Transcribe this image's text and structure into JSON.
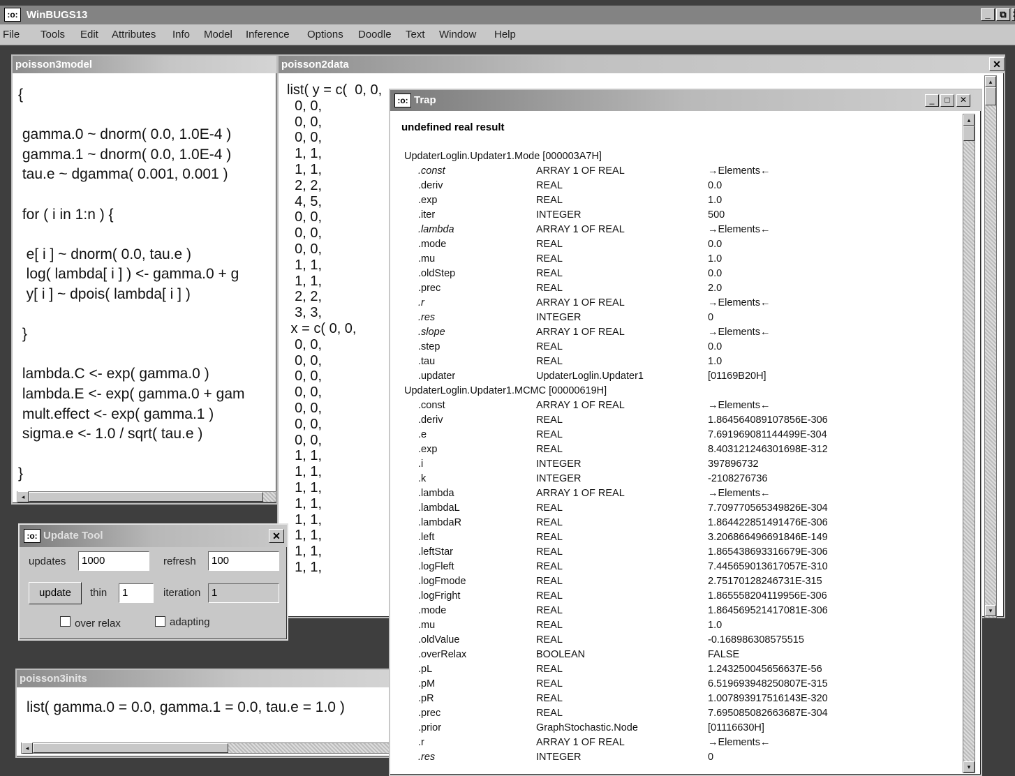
{
  "app": {
    "title": "WinBUGS13",
    "icon": "bug-icon",
    "minimize": "_",
    "restore": "⧉",
    "close": "✕"
  },
  "menu": [
    "File",
    "Tools",
    "Edit",
    "Attributes",
    "Info",
    "Model",
    "Inference",
    "Options",
    "Doodle",
    "Text",
    "Window",
    "Help"
  ],
  "model_window": {
    "title": "poisson3model",
    "code": "{\n\n gamma.0 ~ dnorm( 0.0, 1.0E-4 )\n gamma.1 ~ dnorm( 0.0, 1.0E-4 )\n tau.e ~ dgamma( 0.001, 0.001 )\n\n for ( i in 1:n ) {\n\n  e[ i ] ~ dnorm( 0.0, tau.e )\n  log( lambda[ i ] ) <- gamma.0 + g\n  y[ i ] ~ dpois( lambda[ i ] )\n\n }\n\n lambda.C <- exp( gamma.0 )\n lambda.E <- exp( gamma.0 + gam\n mult.effect <- exp( gamma.1 )\n sigma.e <- 1.0 / sqrt( tau.e )\n\n}"
  },
  "data_window": {
    "title": "poisson2data",
    "code": "list( y = c(  0, 0,\n  0, 0,\n  0, 0,\n  0, 0,\n  1, 1,\n  1, 1,\n  2, 2,\n  4, 5,\n  0, 0,\n  0, 0,\n  0, 0,\n  1, 1,\n  1, 1,\n  2, 2,\n  3, 3,\n x = c( 0, 0,\n  0, 0,\n  0, 0,\n  0, 0,\n  0, 0,\n  0, 0,\n  0, 0,\n  0, 0,\n  1, 1,\n  1, 1,\n  1, 1,\n  1, 1,\n  1, 1,\n  1, 1,\n  1, 1,\n  1, 1,",
    "close": "✕"
  },
  "trap_window": {
    "title": "Trap",
    "heading": "undefined real result",
    "rows": [
      {
        "name": "UpdaterLoglin.Updater1.Mode   [000003A7H]",
        "type": "",
        "value": "",
        "section": true
      },
      {
        "name": ".const",
        "type": "ARRAY 1 OF REAL",
        "value": "→Elements←",
        "italic": true
      },
      {
        "name": ".deriv",
        "type": "REAL",
        "value": "0.0"
      },
      {
        "name": ".exp",
        "type": "REAL",
        "value": "1.0"
      },
      {
        "name": ".iter",
        "type": "INTEGER",
        "value": "500"
      },
      {
        "name": ".lambda",
        "type": "ARRAY 1 OF REAL",
        "value": "→Elements←",
        "italic": true
      },
      {
        "name": ".mode",
        "type": "REAL",
        "value": "0.0"
      },
      {
        "name": ".mu",
        "type": "REAL",
        "value": "1.0"
      },
      {
        "name": ".oldStep",
        "type": "REAL",
        "value": "0.0"
      },
      {
        "name": ".prec",
        "type": "REAL",
        "value": "2.0"
      },
      {
        "name": ".r",
        "type": "ARRAY 1 OF REAL",
        "value": "→Elements←",
        "italic": true
      },
      {
        "name": ".res",
        "type": "INTEGER",
        "value": "0",
        "italic": true
      },
      {
        "name": ".slope",
        "type": "ARRAY 1 OF REAL",
        "value": "→Elements←",
        "italic": true
      },
      {
        "name": ".step",
        "type": "REAL",
        "value": "0.0"
      },
      {
        "name": ".tau",
        "type": "REAL",
        "value": "1.0"
      },
      {
        "name": ".updater",
        "type": "UpdaterLoglin.Updater1",
        "value": "[01169B20H]"
      },
      {
        "name": "UpdaterLoglin.Updater1.MCMC   [00000619H]",
        "type": "",
        "value": "",
        "section": true
      },
      {
        "name": ".const",
        "type": "ARRAY 1 OF REAL",
        "value": "→Elements←"
      },
      {
        "name": ".deriv",
        "type": "REAL",
        "value": "1.864564089107856E-306"
      },
      {
        "name": ".e",
        "type": "REAL",
        "value": "7.691969081144499E-304"
      },
      {
        "name": ".exp",
        "type": "REAL",
        "value": "8.403121246301698E-312"
      },
      {
        "name": ".i",
        "type": "INTEGER",
        "value": "397896732"
      },
      {
        "name": ".k",
        "type": "INTEGER",
        "value": "-2108276736"
      },
      {
        "name": ".lambda",
        "type": "ARRAY 1 OF REAL",
        "value": "→Elements←"
      },
      {
        "name": ".lambdaL",
        "type": "REAL",
        "value": "7.709770565349826E-304"
      },
      {
        "name": ".lambdaR",
        "type": "REAL",
        "value": "1.864422851491476E-306"
      },
      {
        "name": ".left",
        "type": "REAL",
        "value": "3.206866496691846E-149"
      },
      {
        "name": ".leftStar",
        "type": "REAL",
        "value": "1.865438693316679E-306"
      },
      {
        "name": ".logFleft",
        "type": "REAL",
        "value": "7.445659013617057E-310"
      },
      {
        "name": ".logFmode",
        "type": "REAL",
        "value": "2.75170128246731E-315"
      },
      {
        "name": ".logFright",
        "type": "REAL",
        "value": "1.865558204119956E-306"
      },
      {
        "name": ".mode",
        "type": "REAL",
        "value": "1.864569521417081E-306"
      },
      {
        "name": ".mu",
        "type": "REAL",
        "value": "1.0"
      },
      {
        "name": ".oldValue",
        "type": "REAL",
        "value": "-0.168986308575515"
      },
      {
        "name": ".overRelax",
        "type": "BOOLEAN",
        "value": "FALSE"
      },
      {
        "name": ".pL",
        "type": "REAL",
        "value": "1.243250045656637E-56"
      },
      {
        "name": ".pM",
        "type": "REAL",
        "value": "6.519693948250807E-315"
      },
      {
        "name": ".pR",
        "type": "REAL",
        "value": "1.007893917516143E-320"
      },
      {
        "name": ".prec",
        "type": "REAL",
        "value": "7.695085082663687E-304"
      },
      {
        "name": ".prior",
        "type": "GraphStochastic.Node",
        "value": "[01116630H]"
      },
      {
        "name": ".r",
        "type": "ARRAY 1 OF REAL",
        "value": "→Elements←"
      },
      {
        "name": ".res",
        "type": "INTEGER",
        "value": "0",
        "italic": true
      }
    ]
  },
  "update_tool": {
    "title": "Update Tool",
    "updates_label": "updates",
    "updates_value": "1000",
    "refresh_label": "refresh",
    "refresh_value": "100",
    "update_button": "update",
    "thin_label": "thin",
    "thin_value": "1",
    "iteration_label": "iteration",
    "iteration_value": "1",
    "over_relax_label": "over relax",
    "adapting_label": "adapting",
    "close": "✕"
  },
  "inits_window": {
    "title": "poisson3inits",
    "code": "list( gamma.0 = 0.0, gamma.1 = 0.0, tau.e = 1.0 )"
  }
}
